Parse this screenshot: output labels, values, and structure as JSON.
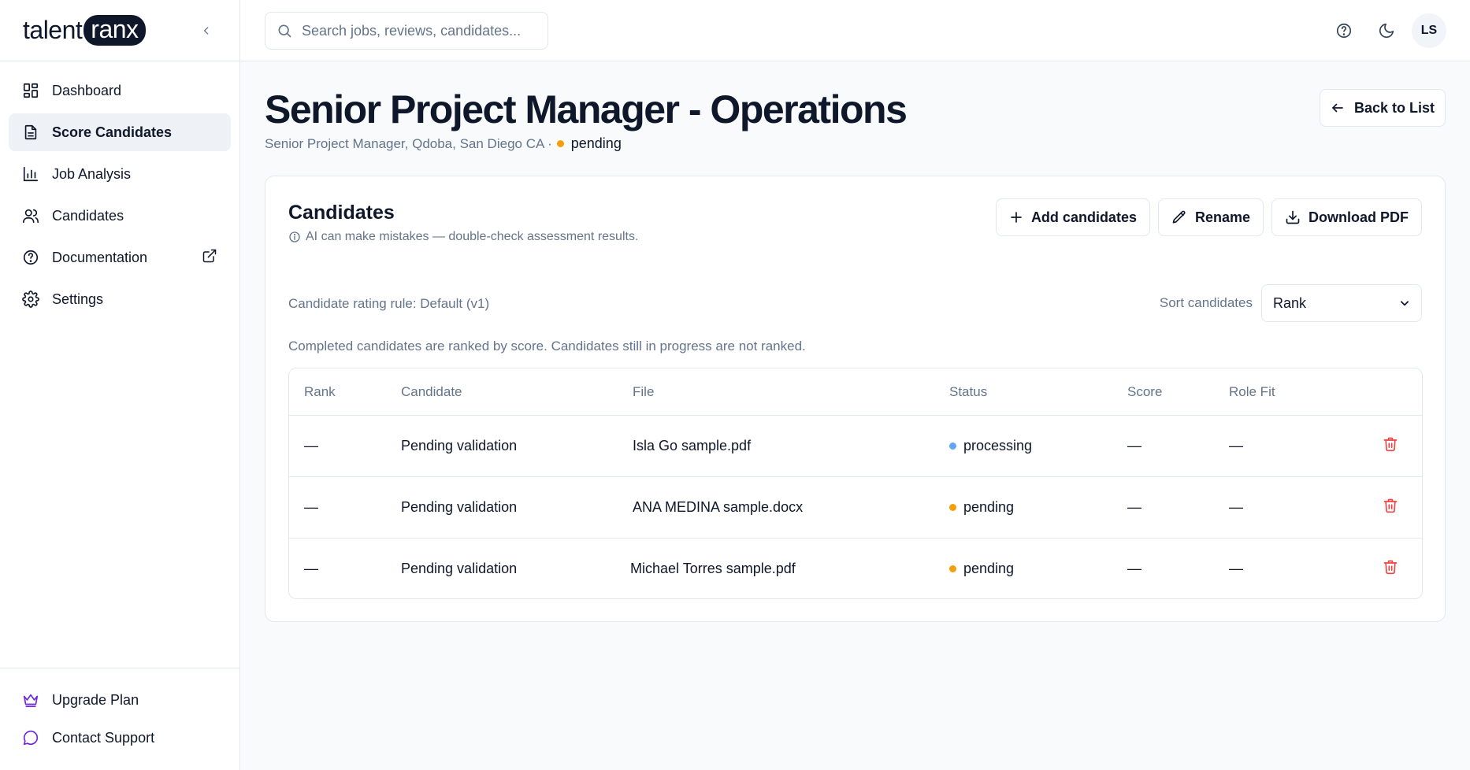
{
  "brand": {
    "word": "talent",
    "pill": "ranx"
  },
  "nav": {
    "items": [
      {
        "label": "Dashboard",
        "icon": "dashboard-icon"
      },
      {
        "label": "Score Candidates",
        "icon": "document-icon"
      },
      {
        "label": "Job Analysis",
        "icon": "bar-chart-icon"
      },
      {
        "label": "Candidates",
        "icon": "users-icon"
      },
      {
        "label": "Documentation",
        "icon": "help-circle-icon"
      },
      {
        "label": "Settings",
        "icon": "gear-icon"
      }
    ],
    "active": "Score Candidates"
  },
  "footer": {
    "upgrade": "Upgrade Plan",
    "support": "Contact Support"
  },
  "topbar": {
    "search_placeholder": "Search jobs, reviews, candidates...",
    "avatar_initials": "LS"
  },
  "job": {
    "title": "Senior Project Manager - Operations",
    "subtitle": "Senior Project Manager, Qdoba, San Diego CA ·",
    "status": "pending",
    "back_label": "Back to List"
  },
  "candidates_card": {
    "title": "Candidates",
    "disclaimer": "AI can make mistakes — double-check assessment results.",
    "add_label": "Add candidates",
    "rename_label": "Rename",
    "download_label": "Download PDF",
    "rating_rule": "Candidate rating rule: Default (v1)",
    "sort_label": "Sort candidates",
    "sort_value": "Rank",
    "ranked_note": "Completed candidates are ranked by score. Candidates still in progress are not ranked."
  },
  "table": {
    "headers": [
      "Rank",
      "Candidate",
      "File",
      "Status",
      "Score",
      "Role Fit"
    ],
    "rows": [
      {
        "rank": "—",
        "candidate": "Pending validation",
        "file": "Isla Go sample.pdf",
        "status": "processing",
        "score": "—",
        "role_fit": "—"
      },
      {
        "rank": "—",
        "candidate": "Pending validation",
        "file": "ANA MEDINA sample.docx",
        "status": "pending",
        "score": "—",
        "role_fit": "—"
      },
      {
        "rank": "—",
        "candidate": "Pending validation",
        "file": "Michael Torres sample.pdf",
        "status": "pending",
        "score": "—",
        "role_fit": "—"
      }
    ]
  },
  "colors": {
    "accent_purple": "#6d28d9",
    "pending": "#f59e0b",
    "processing": "#60a5fa",
    "danger": "#ef4444"
  }
}
